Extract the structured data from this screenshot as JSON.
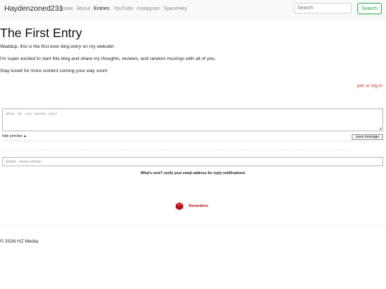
{
  "navbar": {
    "brand": "Haydenzoned231",
    "links": [
      {
        "label": "Home",
        "active": false
      },
      {
        "label": "About",
        "active": false
      },
      {
        "label": "Entries",
        "active": true
      },
      {
        "label": "YouTube",
        "active": false
      },
      {
        "label": "Instagram",
        "active": false
      },
      {
        "label": "SpaceHey",
        "active": false
      }
    ],
    "search": {
      "placeholder": "Search",
      "button_label": "Search"
    }
  },
  "post": {
    "title": "The First Entry",
    "intro_before": "Waddup, this is the first ever ",
    "intro_emphasis": "blog entry",
    "intro_after": " on my website!",
    "paragraph2": "I'm super excited to start this blog and share my thoughts, reviews, and random musings with all of you.",
    "paragraph3": "Stay tuned for more content coming your way soon!"
  },
  "comments": {
    "join_link": "join or log in",
    "textarea_placeholder": "What do you wanna say?",
    "preview_toggle": "hide preview ▲",
    "save_label": "save message",
    "email_placeholder": "Email - never shown",
    "verify_note": "What's next? verify your email address for reply notifications!",
    "remarkbox_label": "Remarkbox",
    "remarkbox_color": "#b5121b"
  },
  "footer": {
    "text": "© 2026 HZ Media"
  },
  "colors": {
    "accent_green": "#28a745",
    "link_red": "#c0392b"
  }
}
